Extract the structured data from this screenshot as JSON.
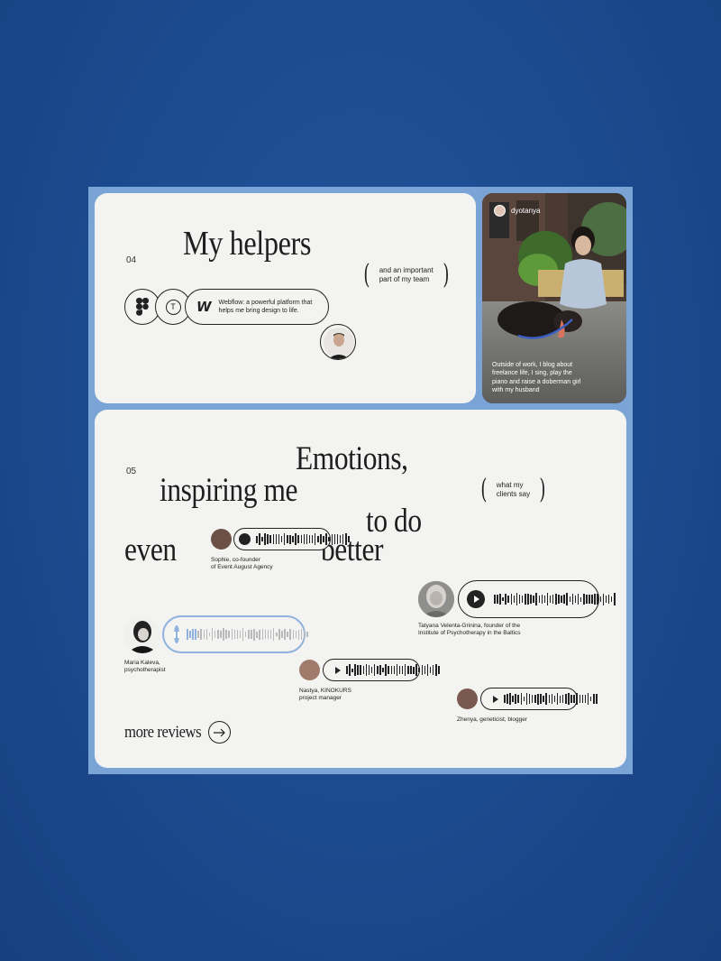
{
  "helpers": {
    "number": "04",
    "title": "My helpers",
    "note": [
      "and an important",
      "part of my team"
    ],
    "tools": [
      {
        "icon": "figma-icon"
      },
      {
        "icon": "tilda-icon",
        "glyph": "T"
      },
      {
        "icon": "webflow-icon",
        "glyph": "W"
      }
    ],
    "webflow_text": [
      "Webflow: a powerful platform that",
      "helps me bring design to life."
    ]
  },
  "profile": {
    "username": "dyotanya",
    "caption": [
      "Outside of work, I blog about",
      "freelance life, I sing, play the",
      "piano and raise a doberman girl",
      "with my husband"
    ]
  },
  "reviews": {
    "number": "05",
    "headline": {
      "w1": "Emotions,",
      "w2": "inspiring me",
      "w3": "to do",
      "w4": "even",
      "w5": "better"
    },
    "note": [
      "what my",
      "clients say"
    ],
    "items": [
      {
        "name": [
          "Sophie, co-founder",
          "of Event August Agency"
        ]
      },
      {
        "name": [
          "Tatyana Velenta-Grinina, founder of the",
          "Institute of Psychotherapy in the Baltics"
        ]
      },
      {
        "name": [
          "Maria Kaleva,",
          "psychotherapist"
        ]
      },
      {
        "name": [
          "Nastya, KINOKURS",
          "project manager"
        ]
      },
      {
        "name": [
          "Zhenya, geneticist, blogger"
        ]
      }
    ],
    "more_label": "more reviews"
  },
  "colors": {
    "background": "#1c4a8e",
    "frame": "#7aa3d6",
    "card": "#f3f3f1",
    "accent": "#8fb2de"
  }
}
